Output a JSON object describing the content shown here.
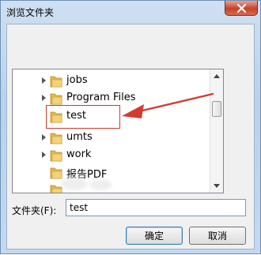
{
  "window": {
    "title": "浏览文件夹"
  },
  "tree": {
    "items": [
      {
        "label": "jobs"
      },
      {
        "label": "Program Files"
      },
      {
        "label": "test"
      },
      {
        "label": "umts"
      },
      {
        "label": "work"
      },
      {
        "label": "报告PDF"
      }
    ]
  },
  "folder_field": {
    "label": "文件夹(F):",
    "value": "test"
  },
  "buttons": {
    "ok": "确定",
    "cancel": "取消"
  },
  "colors": {
    "highlight": "#cc3b2e",
    "folder": "#e8c25a"
  }
}
